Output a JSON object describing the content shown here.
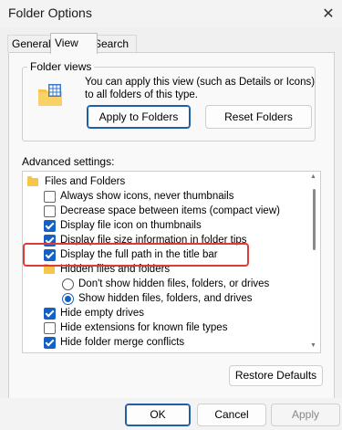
{
  "window": {
    "title": "Folder Options",
    "close": "✕"
  },
  "tabs": [
    {
      "label": "General"
    },
    {
      "label": "View"
    },
    {
      "label": "Search"
    }
  ],
  "folder_views": {
    "legend": "Folder views",
    "description": "You can apply this view (such as Details or Icons) to all folders of this type.",
    "apply_label": "Apply to Folders",
    "reset_label": "Reset Folders"
  },
  "advanced": {
    "label": "Advanced settings:",
    "items": [
      {
        "kind": "folder",
        "label": "Files and Folders"
      },
      {
        "kind": "checkbox",
        "checked": false,
        "label": "Always show icons, never thumbnails"
      },
      {
        "kind": "checkbox",
        "checked": false,
        "label": "Decrease space between items (compact view)"
      },
      {
        "kind": "checkbox",
        "checked": true,
        "label": "Display file icon on thumbnails"
      },
      {
        "kind": "checkbox",
        "checked": true,
        "label": "Display file size information in folder tips"
      },
      {
        "kind": "checkbox",
        "checked": true,
        "label": "Display the full path in the title bar"
      },
      {
        "kind": "folder",
        "label": "Hidden files and folders"
      },
      {
        "kind": "radio",
        "checked": false,
        "label": "Don't show hidden files, folders, or drives"
      },
      {
        "kind": "radio",
        "checked": true,
        "label": "Show hidden files, folders, and drives"
      },
      {
        "kind": "checkbox",
        "checked": true,
        "label": "Hide empty drives"
      },
      {
        "kind": "checkbox",
        "checked": false,
        "label": "Hide extensions for known file types"
      },
      {
        "kind": "checkbox",
        "checked": true,
        "label": "Hide folder merge conflicts"
      }
    ]
  },
  "restore_label": "Restore Defaults",
  "footer": {
    "ok": "OK",
    "cancel": "Cancel",
    "apply": "Apply"
  },
  "colors": {
    "accent": "#1560c1",
    "highlight": "#e03b3b",
    "folder": "#f6c64b"
  },
  "icons": {
    "folder_views": "folder-grid-icon",
    "close": "close-icon",
    "group": "folder-icon"
  }
}
